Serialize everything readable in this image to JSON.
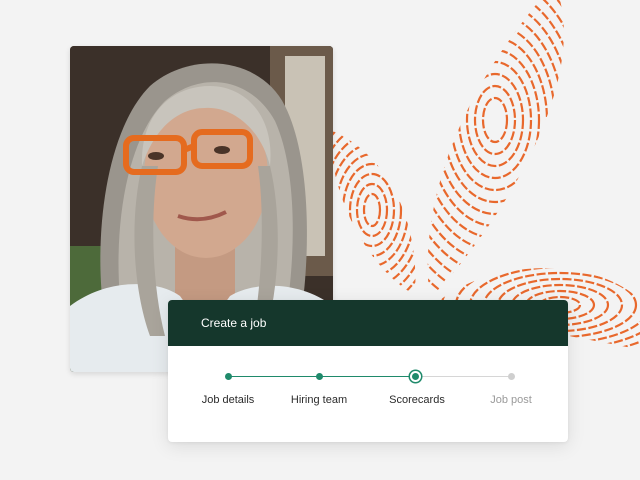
{
  "dialog": {
    "title": "Create a job"
  },
  "steps": [
    {
      "label": "Job details",
      "state": "done"
    },
    {
      "label": "Hiring team",
      "state": "done"
    },
    {
      "label": "Scorecards",
      "state": "current"
    },
    {
      "label": "Job post",
      "state": "todo"
    }
  ],
  "colors": {
    "header_bg": "#15372c",
    "accent": "#1f8a6b",
    "inactive": "#cfcfcf",
    "leaf": "#e8682c",
    "background": "#f3f3f3"
  },
  "photo": {
    "icon": "portrait-photo"
  }
}
